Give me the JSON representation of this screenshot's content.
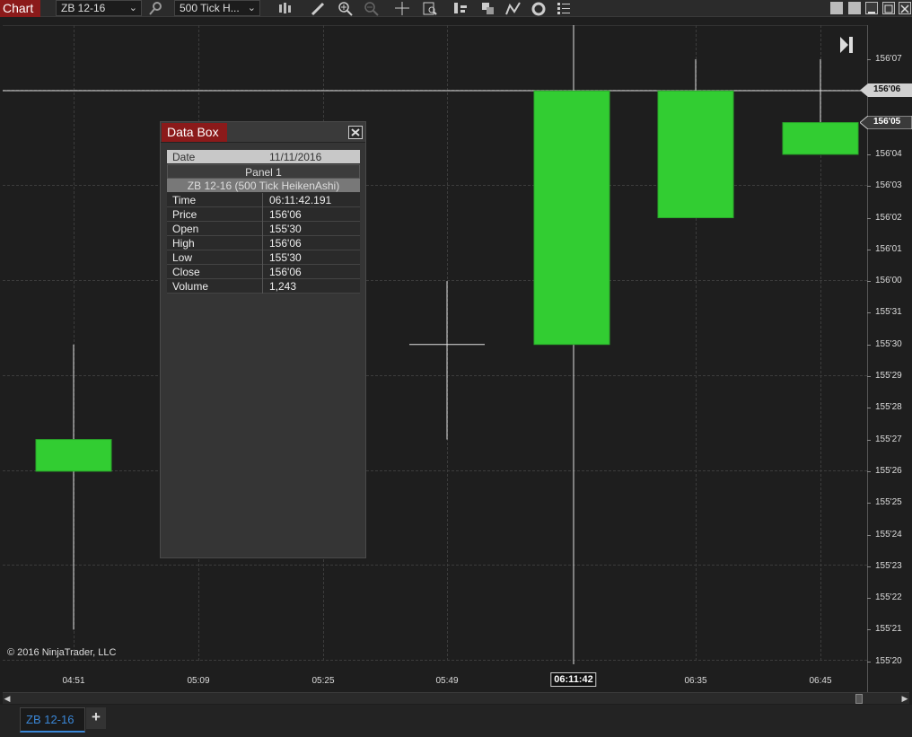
{
  "toolbar": {
    "title": "Chart",
    "instrument": "ZB 12-16",
    "interval": "500 Tick H..."
  },
  "price_axis": {
    "labels": [
      "156'07",
      "156'06",
      "156'05",
      "156'04",
      "156'03",
      "156'02",
      "156'01",
      "156'00",
      "155'31",
      "155'30",
      "155'29",
      "155'28",
      "155'27",
      "155'26",
      "155'25",
      "155'24",
      "155'23",
      "155'22",
      "155'21",
      "155'20"
    ],
    "crosshair_label": "156'06",
    "last_price_label": "156'05"
  },
  "time_axis": {
    "labels": [
      "04:51",
      "05:09",
      "05:25",
      "05:49",
      "06:11:42",
      "06:35",
      "06:45"
    ],
    "crosshair_label": "06:11:42"
  },
  "chart_data": {
    "type": "candlestick",
    "style": "HeikenAshi",
    "colors": {
      "up": "#32cd32",
      "wick": "#e0e0e0",
      "crosshair": "#e0e0e0"
    },
    "candles": [
      {
        "time": "04:51",
        "open": "155'26",
        "close": "155'27",
        "high": "155'30",
        "low": "155'21"
      },
      {
        "time": "05:49",
        "open": "155'30",
        "close": "155'30",
        "high": "156'00",
        "low": "155'27"
      },
      {
        "time": "06:11:42",
        "open": "155'30",
        "close": "156'06",
        "high": "156'06",
        "low": "155'30"
      },
      {
        "time": "06:35",
        "open": "156'02",
        "close": "156'06",
        "high": "156'07",
        "low": "156'02"
      },
      {
        "time": "06:45",
        "open": "156'04",
        "close": "156'05",
        "high": "156'07",
        "low": "156'04"
      }
    ]
  },
  "copyright": "© 2016 NinjaTrader, LLC",
  "databox": {
    "title": "Data Box",
    "date_label": "Date",
    "date_value": "11/11/2016",
    "panel": "Panel 1",
    "instrument": "ZB 12-16 (500 Tick HeikenAshi)",
    "rows": [
      {
        "k": "Time",
        "v": "06:11:42.191"
      },
      {
        "k": "Price",
        "v": "156'06"
      },
      {
        "k": "Open",
        "v": "155'30"
      },
      {
        "k": "High",
        "v": "156'06"
      },
      {
        "k": "Low",
        "v": "155'30"
      },
      {
        "k": "Close",
        "v": "156'06"
      },
      {
        "k": "Volume",
        "v": "1,243"
      }
    ]
  },
  "tabs": [
    {
      "label": "ZB 12-16"
    }
  ],
  "tab_add": "+"
}
